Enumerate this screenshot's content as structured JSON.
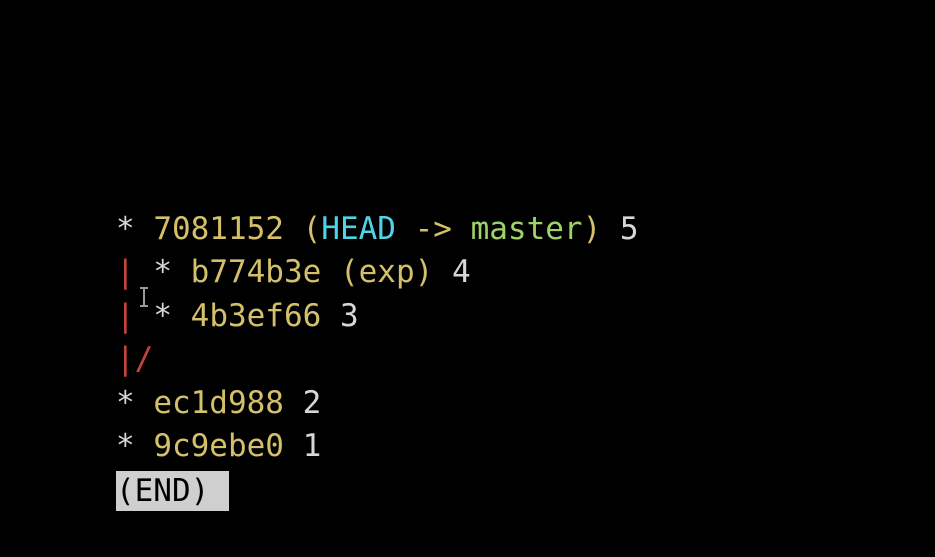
{
  "colors": {
    "background": "#000000",
    "graph_default": "#d7d7d7",
    "graph_branch_line": "#c8443a",
    "commit_hash": "#d4c06a",
    "head_ref": "#4fd3e6",
    "branch_ref": "#9fd36a",
    "message": "#d7d7d7",
    "pager_end_bg": "#cfcfcf"
  },
  "log": {
    "lines": [
      {
        "graph": "* ",
        "hash": "7081152",
        "refs_open": " (",
        "head": "HEAD",
        "arrow": " -> ",
        "branch": "master",
        "refs_close": ")",
        "message": " 5"
      },
      {
        "graph_bar": "|",
        "graph": " * ",
        "hash": "b774b3e",
        "refs_open": " (",
        "branch": "exp",
        "refs_close": ")",
        "message": " 4"
      },
      {
        "graph_bar": "|",
        "graph": " * ",
        "hash": "4b3ef66",
        "message": " 3"
      },
      {
        "graph_merge": "|/"
      },
      {
        "graph": "* ",
        "hash": "ec1d988",
        "message": " 2"
      },
      {
        "graph": "* ",
        "hash": "9c9ebe0",
        "message": " 1"
      }
    ]
  },
  "pager": {
    "end_label": "(END)"
  },
  "cursor": {
    "icon": "text-cursor-icon"
  }
}
